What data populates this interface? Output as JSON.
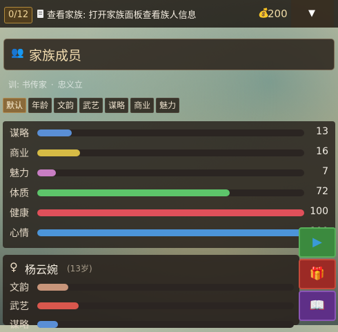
{
  "topbar": {
    "quest_count": "0/12",
    "quest_icon": "scroll-icon",
    "quest_text": "查看家族: 打开家族面板查看族人信息",
    "coin_icon": "money-bag-icon",
    "coin_value": "200",
    "dropdown_symbol": "▼"
  },
  "header": {
    "icon": "family-icon",
    "title": "家族成员"
  },
  "motto": {
    "prefix": "训:",
    "part1": "书传家",
    "part2": "忠义立"
  },
  "tabs": [
    "默认",
    "年龄",
    "文韵",
    "武艺",
    "谋略",
    "商业",
    "魅力"
  ],
  "active_tab": "默认",
  "stats": [
    {
      "label": "谋略",
      "value": 13,
      "max": 100,
      "color": "#5a8fd6"
    },
    {
      "label": "商业",
      "value": 16,
      "max": 100,
      "color": "#d6bb45"
    },
    {
      "label": "魅力",
      "value": 7,
      "max": 100,
      "color": "#c97ec4"
    },
    {
      "label": "体质",
      "value": 72,
      "max": 100,
      "color": "#5dc56a"
    },
    {
      "label": "健康",
      "value": 100,
      "max": 100,
      "color": "#e0505a"
    },
    {
      "label": "心情",
      "value": 100,
      "max": 100,
      "color": "#4c95d9"
    }
  ],
  "member": {
    "gender_symbol": "♀",
    "name": "杨云婉",
    "age": "(13岁)",
    "stats": [
      {
        "label": "文韵",
        "value": 12,
        "max": 100,
        "color": "#c8957a"
      },
      {
        "label": "武艺",
        "value": 16,
        "max": 100,
        "color": "#d9574d"
      },
      {
        "label": "谋略",
        "value": 8,
        "max": 100,
        "color": "#5a8fd6"
      }
    ]
  },
  "side_buttons": {
    "play_symbol": "▶",
    "gift_symbol": "🎁",
    "book_symbol": "📖"
  }
}
